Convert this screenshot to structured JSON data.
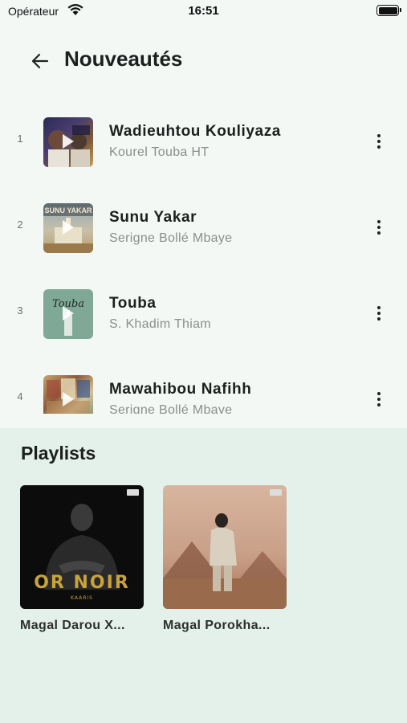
{
  "status_bar": {
    "carrier": "Opérateur",
    "time": "16:51"
  },
  "header": {
    "title": "Nouveautés"
  },
  "tracks": [
    {
      "rank": "1",
      "title": "Wadieuhtou Kouliyaza",
      "artist": "Kourel Touba HT"
    },
    {
      "rank": "2",
      "title": "Sunu Yakar",
      "artist": "Serigne Bollé Mbaye"
    },
    {
      "rank": "3",
      "title": "Touba",
      "artist": "S. Khadim Thiam"
    },
    {
      "rank": "4",
      "title": "Mawahibou Nafihh",
      "artist": "Serigne Bollé Mbaye"
    }
  ],
  "playlists": {
    "heading": "Playlists",
    "items": [
      {
        "name": "Magal Darou X...",
        "cover_text": "OR NOIR",
        "cover_sub": "KAARIS"
      },
      {
        "name": "Magal Porokha..."
      }
    ]
  },
  "art_text": {
    "sunu_yakar": "SUNU YAKAR",
    "touba": "Touba"
  },
  "colors": {
    "background": "#f3f8f5",
    "playlists_background": "#e4f1ea",
    "subtitle": "#8a8e8c"
  }
}
